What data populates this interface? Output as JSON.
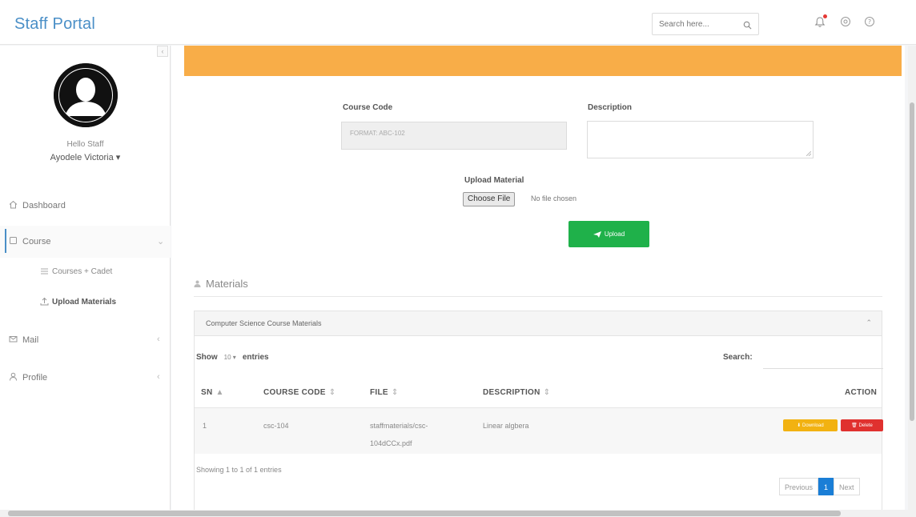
{
  "app": {
    "title": "Staff Portal"
  },
  "header": {
    "search_placeholder": "Search here..."
  },
  "user": {
    "greeting": "Hello Staff",
    "name": "Ayodele Victoria ▾"
  },
  "sidebar": {
    "items": [
      {
        "label": "Dashboard",
        "icon": "home-icon"
      },
      {
        "label": "Course",
        "icon": "book-icon",
        "active": true
      },
      {
        "label": "Mail",
        "icon": "mail-icon"
      },
      {
        "label": "Profile",
        "icon": "user-icon"
      }
    ],
    "course_sub": [
      {
        "label": "Courses + Cadet",
        "icon": "list-icon"
      },
      {
        "label": "Upload Materials",
        "icon": "upload-icon",
        "current": true
      }
    ]
  },
  "form": {
    "course_code_label": "Course Code",
    "course_code_value": "FORMAT: ABC-102",
    "description_label": "Description",
    "upload_label": "Upload Material",
    "choose_file": "Choose File",
    "no_file": "No file chosen",
    "upload_button": "Upload"
  },
  "materials": {
    "section_title": "Materials",
    "panel_title": "Computer Science Course Materials",
    "show_label": "Show",
    "entries_value": "10",
    "entries_label": "entries",
    "search_label": "Search:",
    "columns": [
      "SN",
      "COURSE CODE",
      "FILE",
      "DESCRIPTION",
      "ACTION"
    ],
    "rows": [
      {
        "sn": "1",
        "course_code": "csc-104",
        "file_line1": "staffmaterials/csc-",
        "file_line2": "104dCCx.pdf",
        "description": "Linear algbera"
      }
    ],
    "download_label": "Download",
    "delete_label": "Delete",
    "info": "Showing 1 to 1 of 1 entries",
    "pager": {
      "previous": "Previous",
      "current": "1",
      "next": "Next"
    }
  },
  "colors": {
    "brand": "#4a8fc7",
    "alert": "#f8ad48",
    "upload": "#1fb14a",
    "download": "#f2b211",
    "delete": "#e0312f",
    "page_active": "#1a7ed6"
  }
}
